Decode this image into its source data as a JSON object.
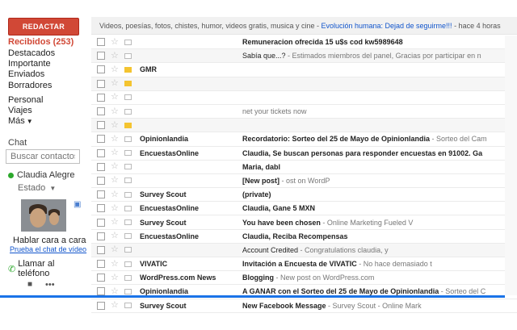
{
  "sidebar": {
    "compose_label": "REDACTAR",
    "nav": [
      {
        "label": "Recibidos (253)",
        "active": true
      },
      {
        "label": "Destacados"
      },
      {
        "label": "Importante"
      },
      {
        "label": "Enviados"
      },
      {
        "label": "Borradores"
      },
      {
        "label": "Personal"
      },
      {
        "label": "Viajes"
      },
      {
        "label": "Más"
      }
    ],
    "chat": {
      "title": "Chat",
      "search_placeholder": "Buscar contactos...",
      "user_name": "Claudia Alegre",
      "status": "Estado",
      "hangout_title": "Hablar cara a cara",
      "hangout_link": "Prueba el chat de vídeo",
      "phone_label": "Llamar al teléfono"
    }
  },
  "ticker": {
    "text": "Videos, poesías, fotos, chistes, humor, videos gratis, musica y cine - ",
    "link": "Evolución humana: Dejad de seguirme!!!",
    "time": " - hace 4 horas"
  },
  "emails": [
    {
      "sender": "",
      "subject": "Remuneracion ofrecida 15 u$s cod kw5989648",
      "snippet": "",
      "unread": true,
      "important": "empty"
    },
    {
      "sender": "",
      "subject": "Sabía que...?",
      "snippet": " - Estimados miembros del panel, Gracias por participar en n",
      "unread": false,
      "important": "empty"
    },
    {
      "sender": "GMR",
      "subject": "",
      "snippet": "",
      "unread": true,
      "important": "yellow"
    },
    {
      "sender": "",
      "subject": "",
      "snippet": "",
      "unread": false,
      "important": "yellow"
    },
    {
      "sender": "",
      "subject": "",
      "snippet": "",
      "unread": true,
      "important": "empty"
    },
    {
      "sender": "",
      "subject": "",
      "snippet": "net your tickets now",
      "unread": true,
      "important": "empty"
    },
    {
      "sender": "",
      "subject": "",
      "snippet": "",
      "unread": false,
      "important": "yellow"
    },
    {
      "sender": "Opinionlandia",
      "subject": "Recordatorio: Sorteo del 25 de Mayo de Opinionlandia",
      "snippet": " - Sorteo del Cam",
      "unread": true,
      "important": "empty"
    },
    {
      "sender": "EncuestasOnline",
      "subject": "Claudia, Se buscan personas para responder encuestas en 91002. Ga",
      "snippet": "",
      "unread": true,
      "important": "empty"
    },
    {
      "sender": "",
      "subject": "Maria, dabl",
      "snippet": "",
      "unread": true,
      "important": "empty"
    },
    {
      "sender": "",
      "subject": "[New post]",
      "snippet": " - ost on WordP",
      "unread": true,
      "important": "empty"
    },
    {
      "sender": "Survey Scout",
      "subject": "(private)",
      "snippet": "",
      "unread": true,
      "important": "empty"
    },
    {
      "sender": "EncuestasOnline",
      "subject": "Claudia, Gane 5 MXN",
      "snippet": "",
      "unread": true,
      "important": "empty"
    },
    {
      "sender": "Survey Scout",
      "subject": "You have been chosen",
      "snippet": " - Online Marketing Fueled V",
      "unread": true,
      "important": "empty"
    },
    {
      "sender": "EncuestasOnline",
      "subject": "Claudia, Reciba Recompensas",
      "snippet": "",
      "unread": true,
      "important": "empty"
    },
    {
      "sender": "",
      "subject": "Account Credited",
      "snippet": " - Congratulations claudia, y",
      "unread": false,
      "important": "empty"
    },
    {
      "sender": "VIVATIC",
      "subject": "Invitación a Encuesta de VIVATIC",
      "snippet": " - No hace demasiado t",
      "unread": true,
      "important": "empty"
    },
    {
      "sender": "WordPress.com News",
      "subject": "Blogging",
      "snippet": " - New post on WordPress.com",
      "unread": true,
      "important": "empty"
    },
    {
      "sender": "Opinionlandia",
      "subject": "A GANAR con el Sorteo del 25 de Mayo de Opinionlandia",
      "snippet": " - Sorteo del C",
      "unread": true,
      "important": "empty"
    },
    {
      "sender": "Survey Scout",
      "subject": "New Facebook Message",
      "snippet": " - Survey Scout - Online Mark",
      "unread": true,
      "important": "empty"
    }
  ]
}
